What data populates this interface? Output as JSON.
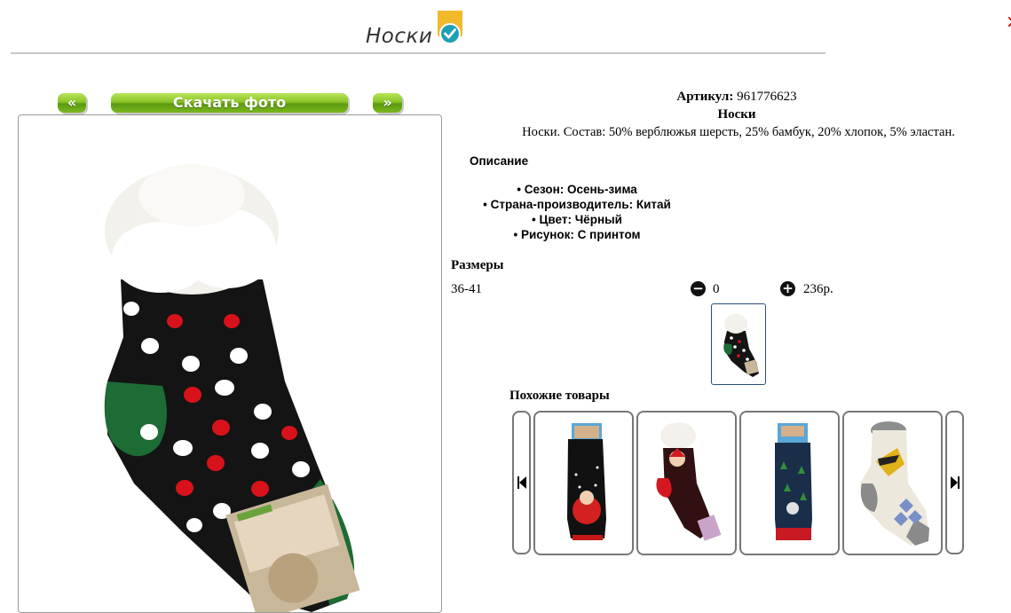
{
  "header": {
    "title": "Носки",
    "badge_icon": "verified-check-icon",
    "colors": {
      "badge_bg": "#f2b92c",
      "badge_check": "#1e9fb4"
    }
  },
  "gallery": {
    "prev_label": "«",
    "download_label": "Скачать фото",
    "next_label": "»",
    "button_color": "#8cc628"
  },
  "product": {
    "article_label": "Артикул:",
    "article_value": "961776623",
    "name": "Носки",
    "composition": "Носки. Состав: 50% верблюжья шерсть, 25% бамбук, 20% хлопок, 5% эластан.",
    "description_title": "Описание",
    "features": [
      "Сезон: Осень-зима",
      "Страна-производитель: Китай",
      "Цвет: Чёрный",
      "Рисунок: С принтом"
    ]
  },
  "sizes": {
    "title": "Размеры",
    "rows": [
      {
        "size": "36-41",
        "quantity": "0",
        "price": "236р."
      }
    ],
    "minus_icon": "minus-circle-icon",
    "plus_icon": "plus-circle-icon"
  },
  "similar": {
    "title": "Похожие товары",
    "prev_icon": "skip-previous-icon",
    "next_icon": "skip-next-icon"
  }
}
